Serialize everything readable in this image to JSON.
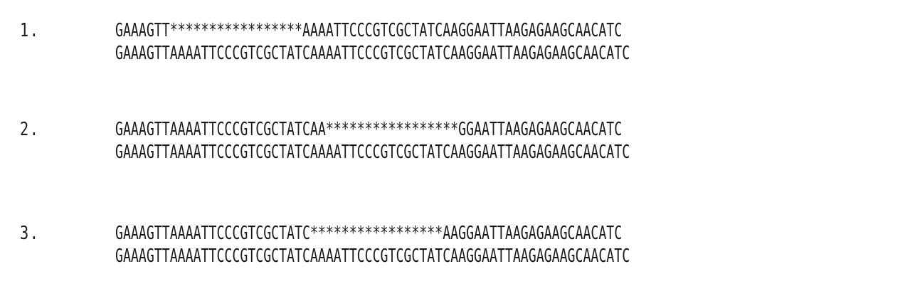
{
  "alignments": [
    {
      "number": "1.",
      "query": "GAAAGTT*****************AAAATTCCCGTCGCTATCAAGGAATTAAGAGAAGCAACATC",
      "reference": "GAAAGTTAAAATTCCCGTCGCTATCAAAATTCCCGTCGCTATCAAGGAATTAAGAGAAGCAACATC"
    },
    {
      "number": "2.",
      "query": "GAAAGTTAAAATTCCCGTCGCTATCAA*****************GGAATTAAGAGAAGCAACATC",
      "reference": "GAAAGTTAAAATTCCCGTCGCTATCAAAATTCCCGTCGCTATCAAGGAATTAAGAGAAGCAACATC"
    },
    {
      "number": "3.",
      "query": "GAAAGTTAAAATTCCCGTCGCTATC*****************AAGGAATTAAGAGAAGCAACATC",
      "reference": "GAAAGTTAAAATTCCCGTCGCTATCAAAATTCCCGTCGCTATCAAGGAATTAAGAGAAGCAACATC"
    }
  ]
}
